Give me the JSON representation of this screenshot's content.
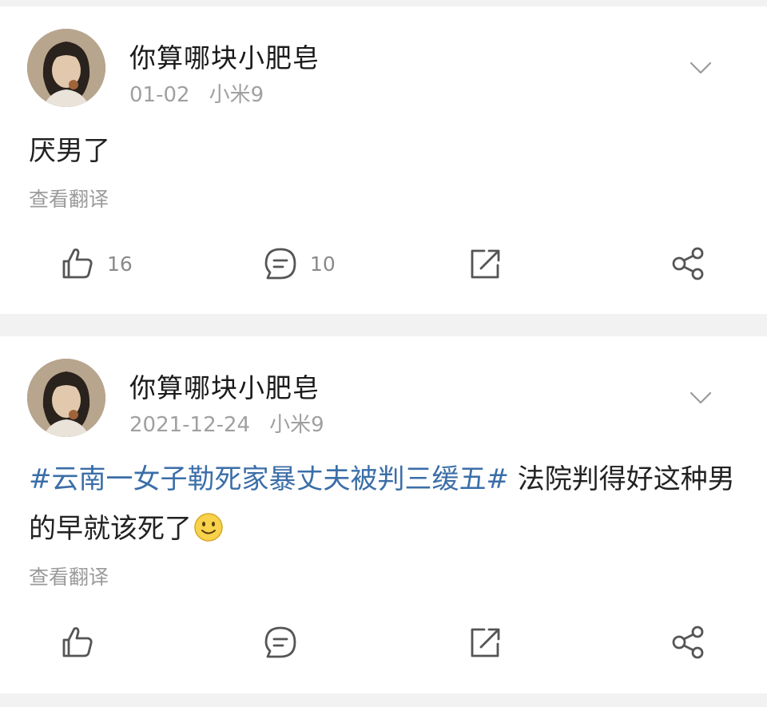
{
  "posts": [
    {
      "username": "你算哪块小肥皂",
      "date": "01-02",
      "device": "小米9",
      "text": "厌男了",
      "translate_label": "查看翻译",
      "likes": "16",
      "comments": "10",
      "icons": [
        "avatar-photo",
        "chevron-down-icon",
        "like-icon",
        "comment-icon",
        "repost-icon",
        "share-icon"
      ]
    },
    {
      "username": "你算哪块小肥皂",
      "date": "2021-12-24",
      "device": "小米9",
      "hashtag": "#云南一女子勒死家暴丈夫被判三缓五#",
      "text_after_hashtag": " 法院判得好这种男的早就该死了",
      "translate_label": "查看翻译",
      "icons": [
        "avatar-photo",
        "chevron-down-icon",
        "smile-emoji",
        "like-icon",
        "comment-icon",
        "repost-icon",
        "share-icon"
      ]
    }
  ],
  "colors": {
    "hashtag": "#3b6ea8",
    "meta_text": "#a0a0a0",
    "icon_stroke": "#555555",
    "background": "#f2f2f2"
  }
}
